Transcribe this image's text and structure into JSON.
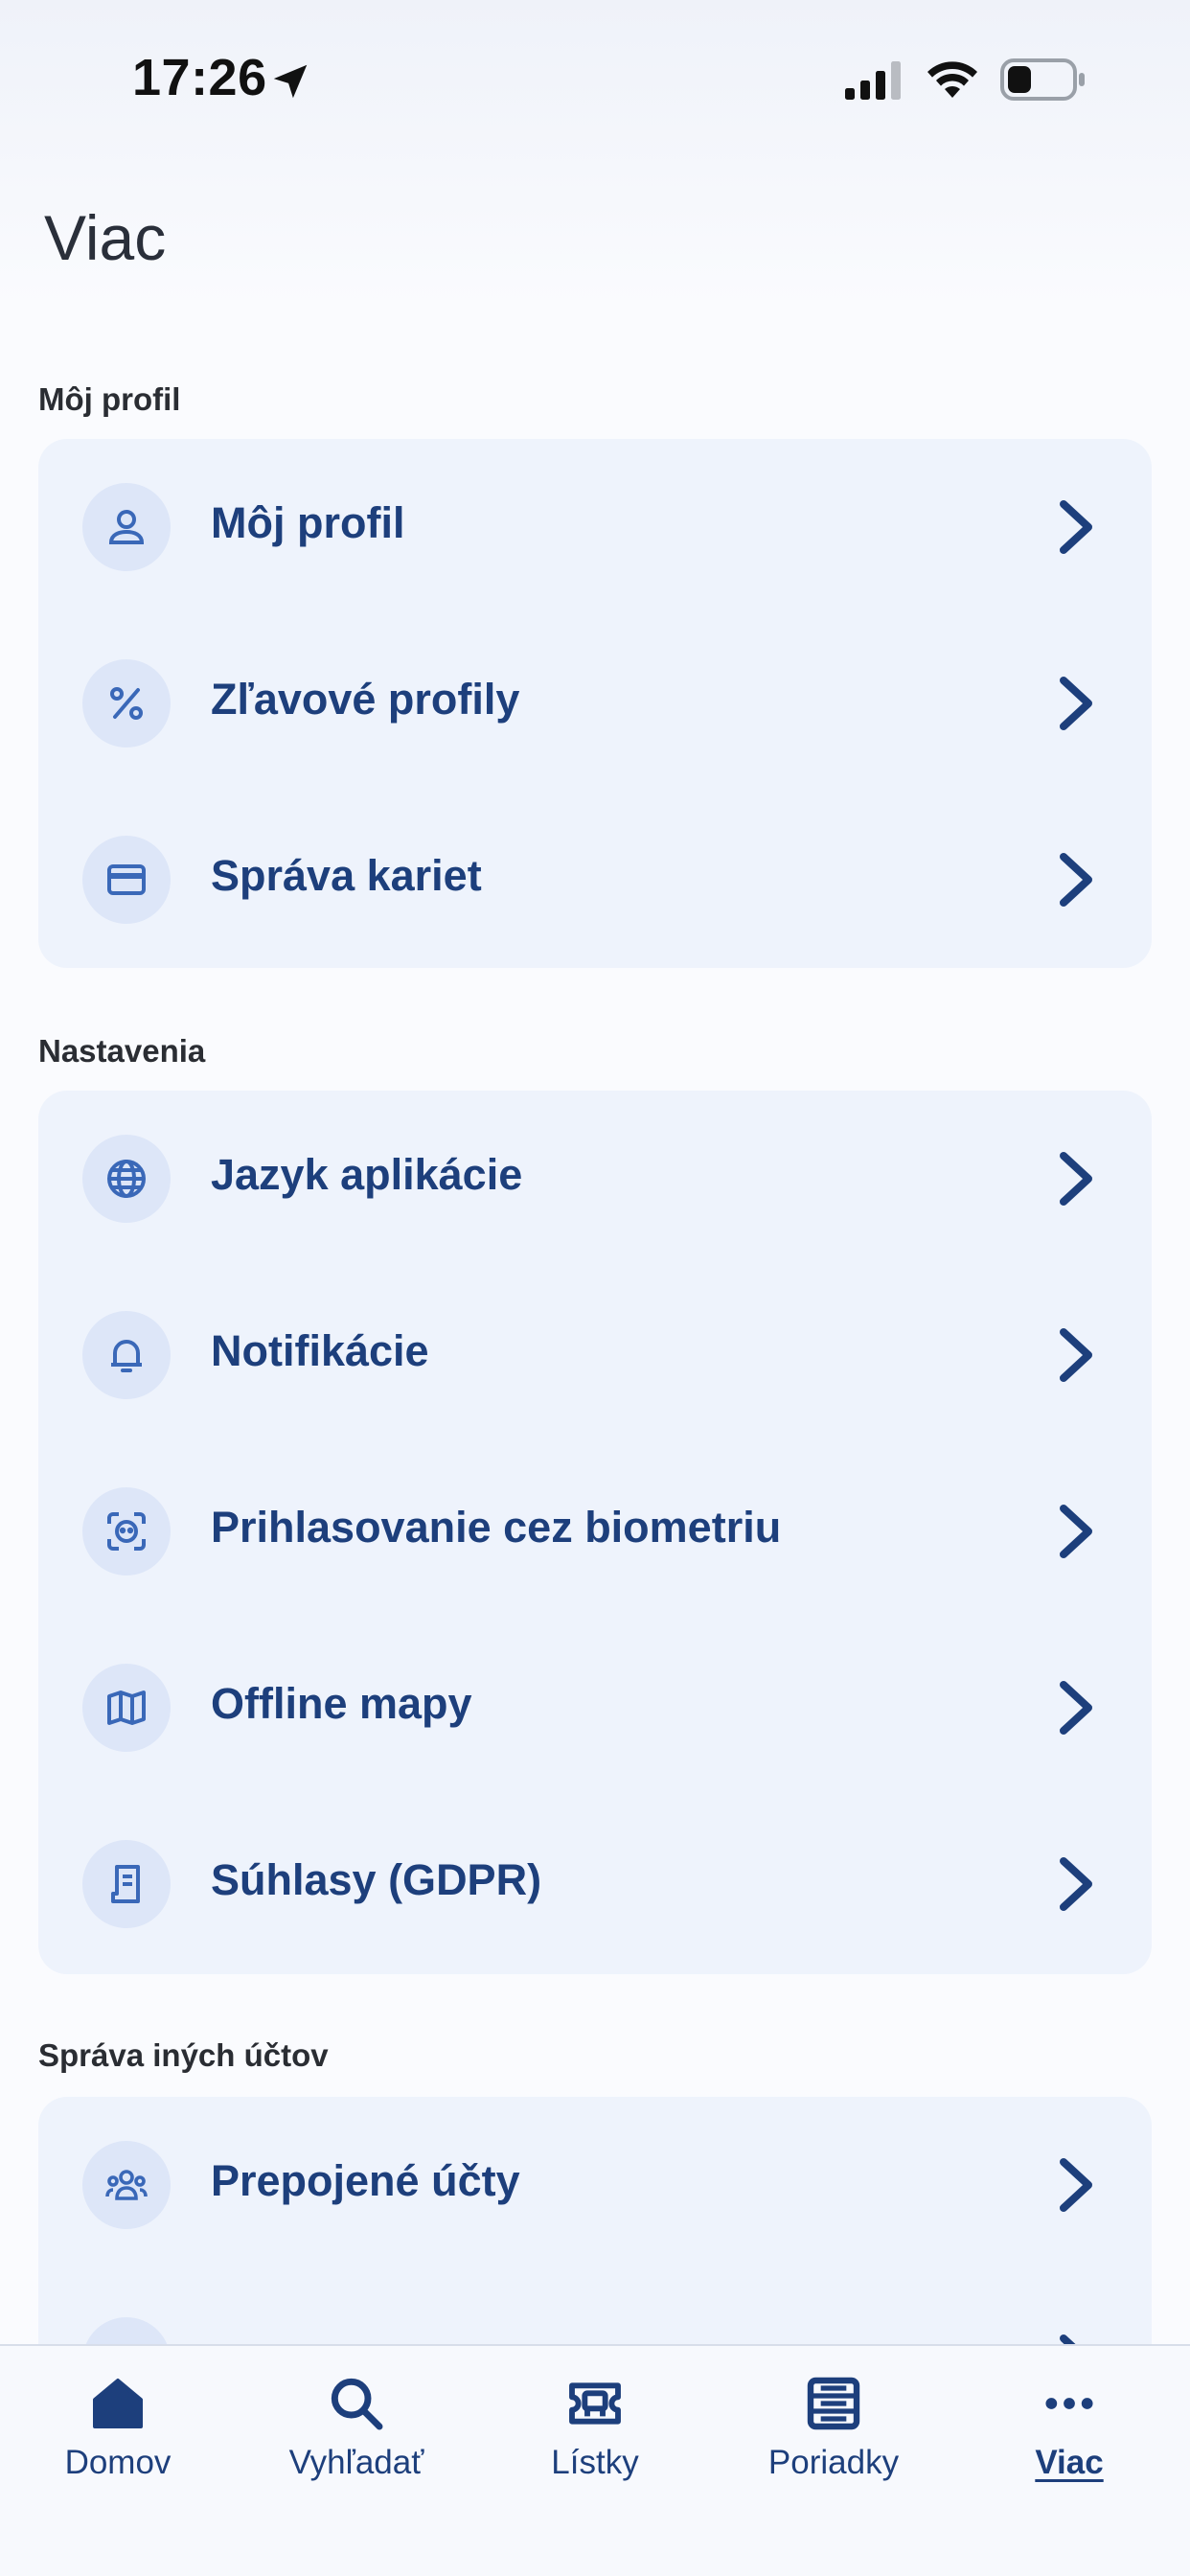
{
  "status_bar": {
    "time": "17:26"
  },
  "header": {
    "title": "Viac"
  },
  "sections": [
    {
      "title": "Môj profil",
      "items": [
        {
          "label": "Môj profil",
          "icon": "person-icon"
        },
        {
          "label": "Zľavové profily",
          "icon": "percent-icon"
        },
        {
          "label": "Správa kariet",
          "icon": "credit-card-icon"
        }
      ]
    },
    {
      "title": "Nastavenia",
      "items": [
        {
          "label": "Jazyk aplikácie",
          "icon": "globe-icon"
        },
        {
          "label": "Notifikácie",
          "icon": "bell-icon"
        },
        {
          "label": "Prihlasovanie cez biometriu",
          "icon": "face-id-icon"
        },
        {
          "label": "Offline mapy",
          "icon": "map-icon"
        },
        {
          "label": "Súhlasy (GDPR)",
          "icon": "document-icon"
        }
      ]
    },
    {
      "title": "Správa iných účtov",
      "items": [
        {
          "label": "Prepojené účty",
          "icon": "people-icon"
        }
      ]
    }
  ],
  "bottom_nav": [
    {
      "label": "Domov",
      "icon": "home-icon",
      "active": false
    },
    {
      "label": "Vyhľadať",
      "icon": "search-icon",
      "active": false
    },
    {
      "label": "Lístky",
      "icon": "ticket-icon",
      "active": false
    },
    {
      "label": "Poriadky",
      "icon": "timetable-icon",
      "active": false
    },
    {
      "label": "Viac",
      "icon": "more-icon",
      "active": true
    }
  ],
  "colors": {
    "primary": "#1d3f7c",
    "icon": "#3a68b8",
    "card": "#eef3fc",
    "icon_bg": "#dde6f8"
  }
}
